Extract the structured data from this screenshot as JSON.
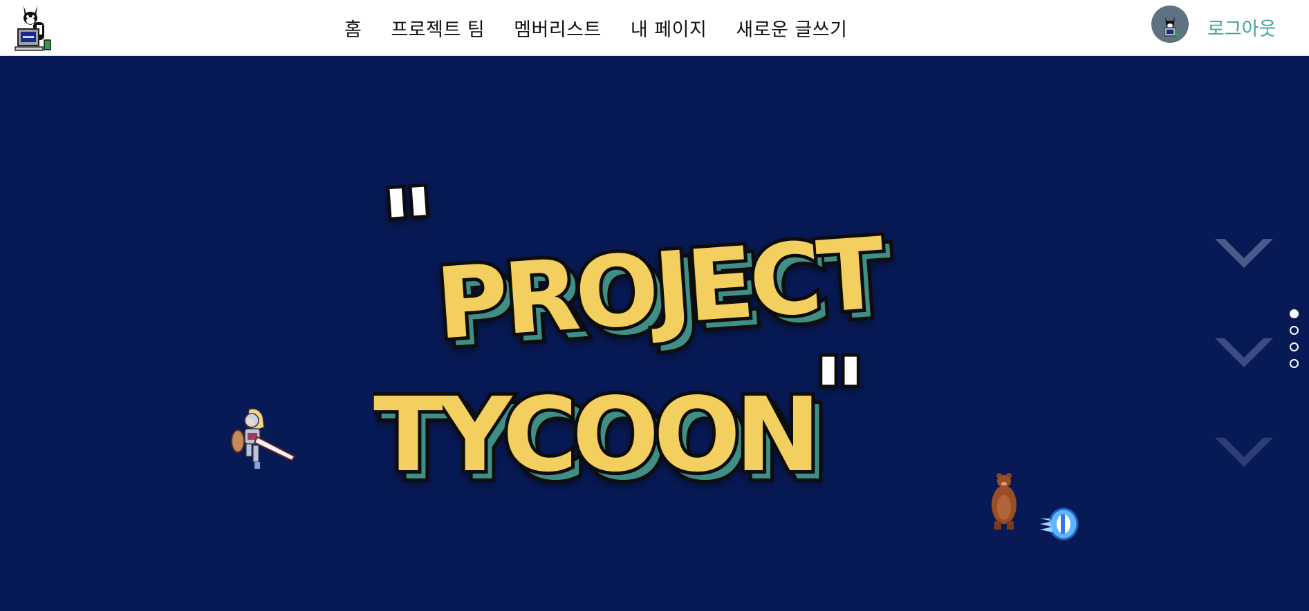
{
  "nav": {
    "items": [
      {
        "label": "홈"
      },
      {
        "label": "프로젝트 팀"
      },
      {
        "label": "멤버리스트"
      },
      {
        "label": "내 페이지"
      },
      {
        "label": "새로운 글쓰기"
      }
    ],
    "logout_label": "로그아웃",
    "logo_icon": "cat-computer-logo",
    "avatar_icon": "user-avatar"
  },
  "hero": {
    "title_line1": "PROJECT",
    "title_line2": "TYCOON",
    "open_quote": "\"",
    "close_quote": "\"",
    "scroll_indicator_icons": [
      "chevron-down-icon",
      "chevron-down-icon",
      "chevron-down-icon"
    ],
    "pagination": {
      "total": 4,
      "active": 1
    },
    "sprites": [
      "knight-sprite",
      "bear-sprite",
      "ice-fireball-sprite"
    ]
  },
  "colors": {
    "hero_background": "#081a56",
    "title_yellow": "#f2cf5e",
    "title_shadow": "#3f8f86",
    "title_outline": "#0b0b0b",
    "logout_teal": "#3aa59a",
    "avatar_bg": "#5f7283"
  }
}
